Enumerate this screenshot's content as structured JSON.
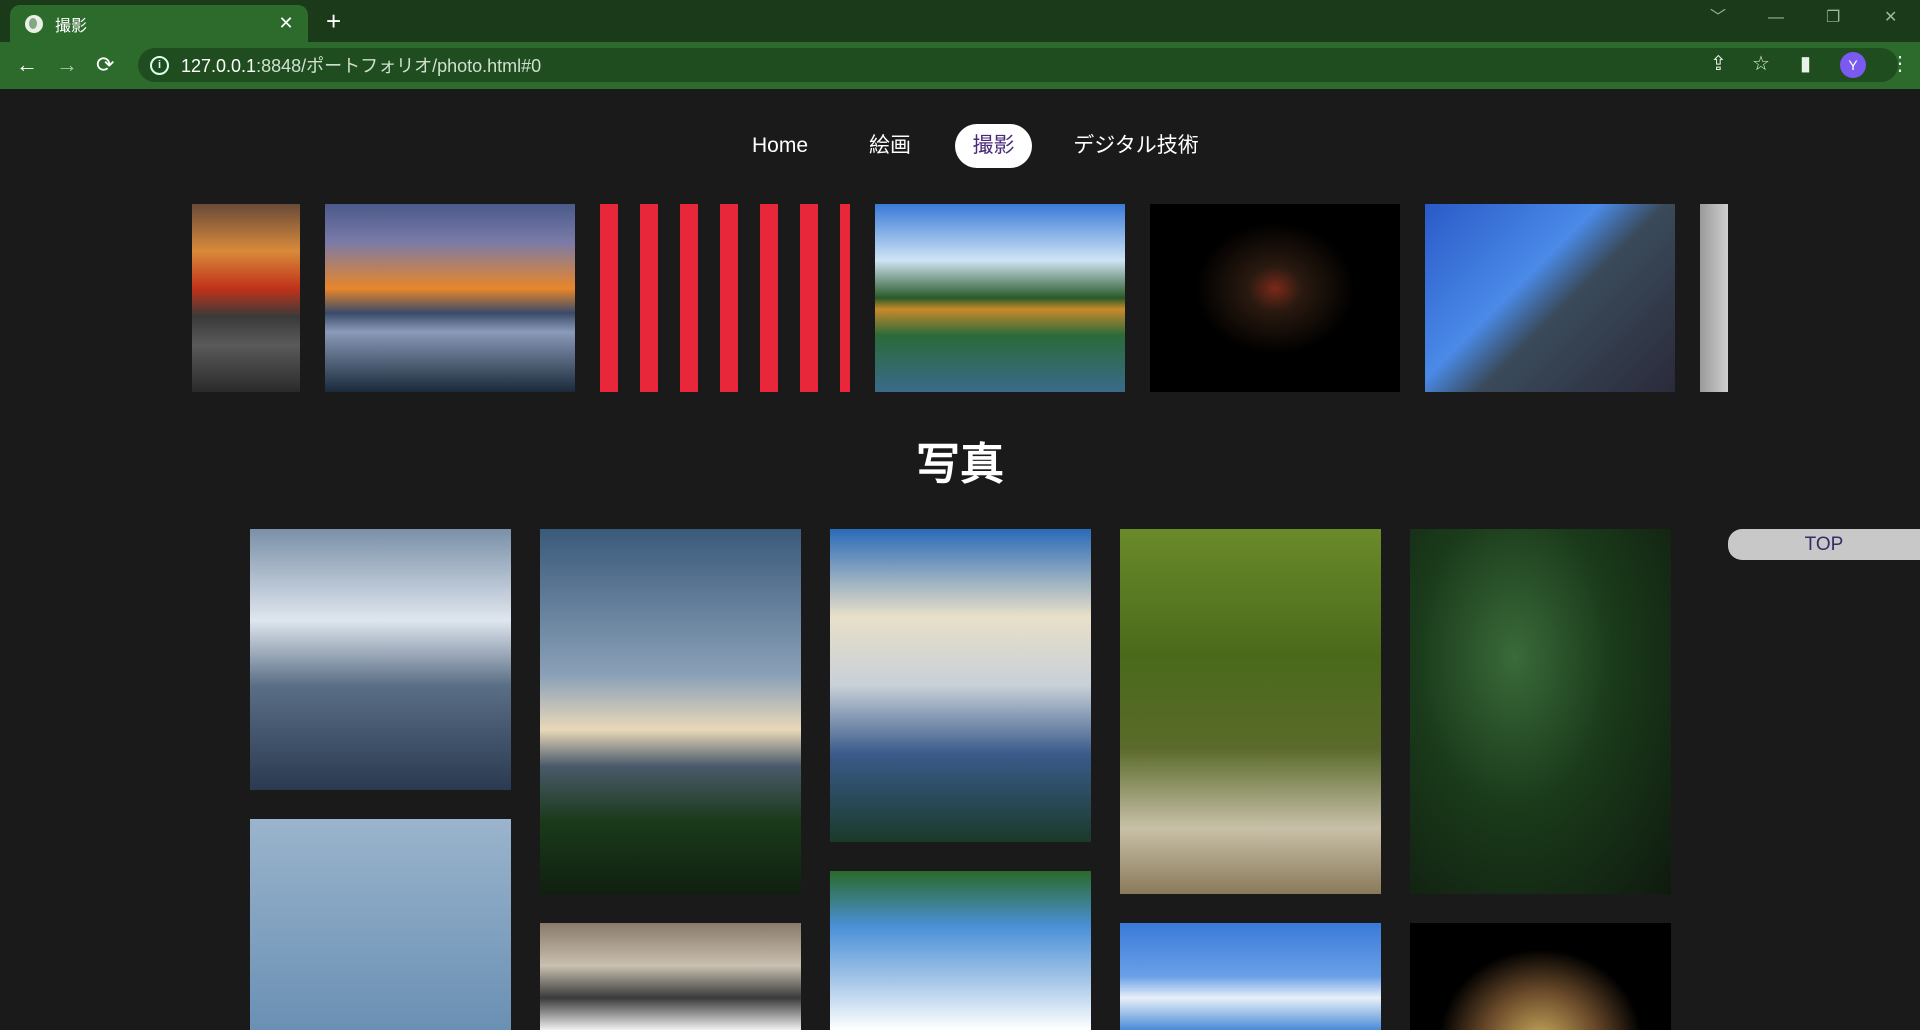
{
  "browser": {
    "tab_title": "撮影",
    "close_glyph": "✕",
    "new_tab_glyph": "+",
    "url_host": "127.0.0.1",
    "url_rest": ":8848/ポートフォリオ/photo.html#0",
    "avatar_letter": "Y",
    "icons": [
      "globe-icon",
      "close-icon",
      "plus-icon",
      "back-icon",
      "forward-icon",
      "reload-icon",
      "info-icon",
      "share-icon",
      "star-icon",
      "sidepanel-icon",
      "menu-icon"
    ]
  },
  "nav": {
    "items": [
      "Home",
      "絵画",
      "撮影",
      "デジタル技術"
    ],
    "active": "撮影"
  },
  "carousel": {
    "photos": [
      "sunset-clouds",
      "mountain-sunrise",
      "red-lattice-gate",
      "golden-pavilion",
      "night-torii-path",
      "brick-wall-streetlamp",
      "white-building"
    ]
  },
  "heading": "写真",
  "gallery": {
    "photos": [
      "snow-mountain-pale",
      "snow-peak-framed-pines",
      "snow-mountain-blue-sky",
      "mossy-tree-roots",
      "dark-jungle-leaves",
      "blue-sea-boat",
      "city-street-crossing",
      "leaves-white-clouds",
      "blue-sky-cloud",
      "ornate-plate"
    ]
  },
  "top_button": "TOP",
  "colors": {
    "chrome_green": "#2d6b2d",
    "page_bg": "#1a1a1a",
    "active_pill": "#ffffff"
  }
}
